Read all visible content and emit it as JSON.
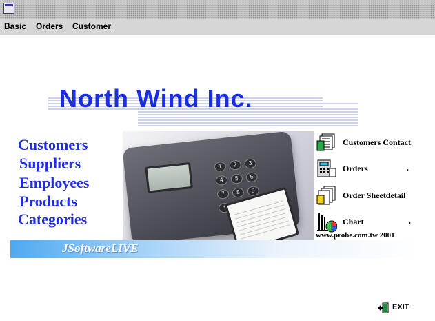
{
  "menu": {
    "items": [
      {
        "label": "Basic"
      },
      {
        "label": "Orders"
      },
      {
        "label": "Customer"
      }
    ]
  },
  "banner": {
    "title": "North Wind Inc.",
    "brand": "JSoftwareLIVE",
    "website": "www.probe.com.tw  2001"
  },
  "categories": [
    "Customers",
    "Suppliers",
    "Employees",
    "Products",
    "Categories"
  ],
  "actions": [
    {
      "label": "Customers Contact",
      "icon": "contacts-list-icon"
    },
    {
      "label": "Orders",
      "icon": "calculator-icon"
    },
    {
      "label": "Order Sheetdetail",
      "icon": "documents-icon"
    },
    {
      "label": "Chart",
      "icon": "pie-chart-icon"
    }
  ],
  "exit": {
    "label": "EXIT",
    "icon": "exit-door-icon"
  },
  "colors": {
    "title_blue": "#1a2ee0",
    "ribbon_blue": "#4fa9f0",
    "menu_bg": "#d6d6d6"
  }
}
